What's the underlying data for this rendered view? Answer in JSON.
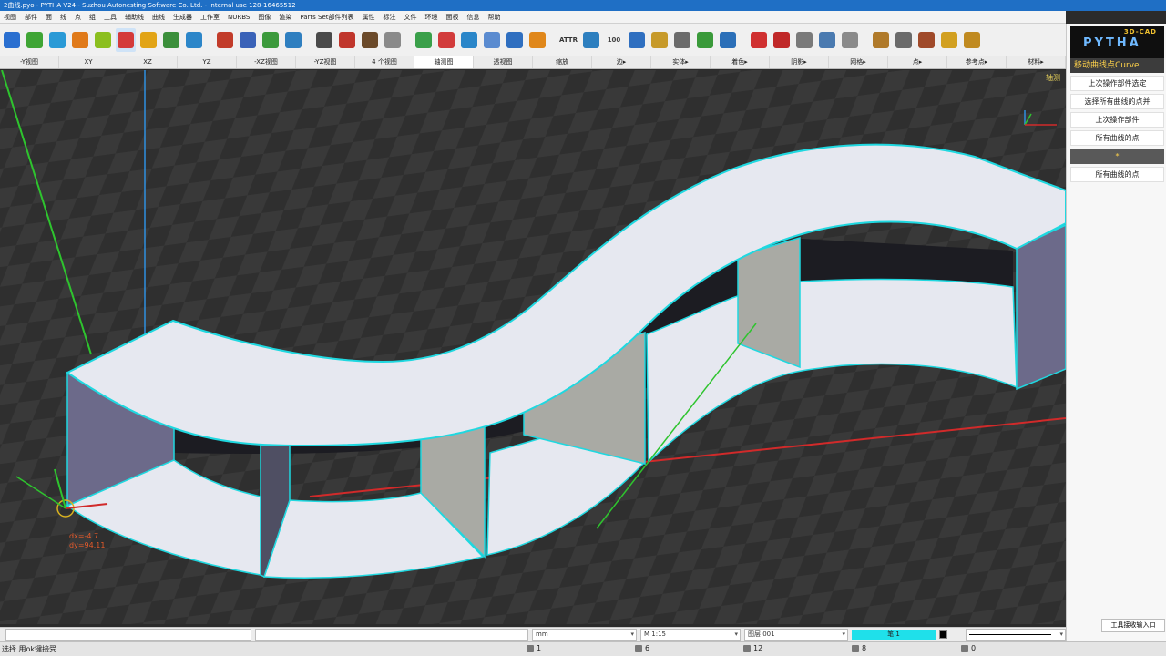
{
  "window": {
    "title": "2曲线.pyo - PYTHA V24 -        Suzhou Autonesting Software Co. Ltd. - Internal use    128-16465512"
  },
  "menu": [
    "视图",
    "部件",
    "面",
    "线",
    "点",
    "组",
    "工具",
    "辅助线",
    "曲线",
    "生成器",
    "工作室",
    "NURBS",
    "图像",
    "渲染",
    "Parts Set部件列表",
    "属性",
    "标注",
    "文件",
    "环境",
    "面板",
    "信息",
    "帮助"
  ],
  "toolbar": {
    "tools": [
      {
        "icon": "cube-arrow-icon",
        "color": "#2a6fd0"
      },
      {
        "icon": "green-block-icon",
        "color": "#3fa535"
      },
      {
        "icon": "plane-icon",
        "color": "#2a9ad6"
      },
      {
        "icon": "dots-icon",
        "color": "#e07a1a"
      },
      {
        "icon": "star-curve-icon",
        "color": "#8bbf1f"
      },
      {
        "icon": "curve-edit-icon",
        "color": "#d43a3a",
        "active": true
      },
      {
        "icon": "pattern-icon",
        "color": "#e2a416"
      },
      {
        "icon": "extrude-icon",
        "color": "#3b8f3b"
      },
      {
        "icon": "funnel-icon",
        "color": "#2c86c9"
      },
      {
        "sep": true
      },
      {
        "icon": "brush-red-icon",
        "color": "#c23c2a"
      },
      {
        "icon": "brush-blue-icon",
        "color": "#3a62b8"
      },
      {
        "icon": "brush-green-icon",
        "color": "#3c9a3c"
      },
      {
        "icon": "brush-pen-icon",
        "color": "#2f7fc0"
      },
      {
        "sep": true
      },
      {
        "icon": "person-icon",
        "color": "#4a4a4a"
      },
      {
        "icon": "figure-red-icon",
        "color": "#c0362c"
      },
      {
        "icon": "eye-icon",
        "color": "#6b4a2a"
      },
      {
        "icon": "eraser-icon",
        "color": "#8a8a8a"
      },
      {
        "sep": true
      },
      {
        "icon": "arrow-up-icon",
        "color": "#3aa04a"
      },
      {
        "icon": "rocket-icon",
        "color": "#d23b3b"
      },
      {
        "icon": "hook-icon",
        "color": "#2a86c9"
      },
      {
        "icon": "cup-icon",
        "color": "#5a8bd0"
      },
      {
        "icon": "undo-icon",
        "color": "#2f6fc0"
      },
      {
        "icon": "redo-icon",
        "color": "#e0871a"
      },
      {
        "sep": true
      },
      {
        "icon": "attr-icon",
        "color": "#333333",
        "text": "ATTR"
      },
      {
        "icon": "list-icon",
        "color": "#2d7fbf"
      },
      {
        "icon": "counter-icon",
        "color": "#444444",
        "text": "100"
      },
      {
        "icon": "text-t-icon",
        "color": "#2f6fc0"
      },
      {
        "icon": "hatch-icon",
        "color": "#c79a2a"
      },
      {
        "icon": "box-icon",
        "color": "#6b6b6b"
      },
      {
        "icon": "tree-icon",
        "color": "#3a9a3a"
      },
      {
        "icon": "info-icon",
        "color": "#2b6fb8"
      },
      {
        "sep": true
      },
      {
        "icon": "target-icon",
        "color": "#d03030"
      },
      {
        "icon": "close-red-icon",
        "color": "#c02828"
      },
      {
        "icon": "cabinet-icon",
        "color": "#7a7a7a"
      },
      {
        "icon": "cabinet-blue-icon",
        "color": "#4a7ab0"
      },
      {
        "icon": "cylinder-icon",
        "color": "#8a8a8a"
      },
      {
        "sep": true
      },
      {
        "icon": "books-icon",
        "color": "#b07a2a"
      },
      {
        "icon": "pencil-icon",
        "color": "#6a6a6a"
      },
      {
        "icon": "tools-icon",
        "color": "#a04a2a"
      },
      {
        "icon": "bread-icon",
        "color": "#d2a020"
      },
      {
        "icon": "scissors-icon",
        "color": "#c08a20"
      }
    ]
  },
  "viewbar": [
    "-Y视图",
    "XY",
    "XZ",
    "YZ",
    "-XZ视图",
    "-YZ视图",
    "4 个视图",
    "轴测图",
    "透视图",
    "缩放",
    "边▸",
    "实体▸",
    "着色▸",
    "阴影▸",
    "网格▸",
    "点▸",
    "参考点▸",
    "材料▸"
  ],
  "viewbar_active": 7,
  "viewport": {
    "view_label": "轴测",
    "coord_readout": "dx=-4.7\ndy=94.11",
    "colors": {
      "background": "#2f2f2f",
      "surface": "#e6e8f0",
      "edge": "#1fd8e0",
      "x_axis": "#d12a2a",
      "y_axis": "#2f8fe0",
      "z_axis": "#2ec42e"
    }
  },
  "panel": {
    "logo_top": "3D-CAD",
    "logo_main": "PYTHA",
    "title": "移动曲线点Curve",
    "items": [
      {
        "label": "上次操作部件选定",
        "dark": false
      },
      {
        "label": "选择所有曲线的点并",
        "dark": false
      },
      {
        "label": "上次操作部件",
        "dark": false
      },
      {
        "label": "所有曲线的点",
        "dark": false
      },
      {
        "label": "*",
        "dark": true
      },
      {
        "label": "所有曲线的点",
        "dark": false
      }
    ],
    "footer": "工具接收输入口"
  },
  "cmdbar": {
    "unit": "mm",
    "scale": "M 1:15",
    "layer": "图层 001",
    "pen": "笔 1"
  },
  "status": {
    "text": "选择 用ok键接受",
    "stats": [
      {
        "icon": "parts-icon",
        "value": "1"
      },
      {
        "icon": "faces-icon",
        "value": "6"
      },
      {
        "icon": "lines-icon",
        "value": "12"
      },
      {
        "icon": "points-icon",
        "value": "8"
      },
      {
        "icon": "groups-icon",
        "value": "0"
      }
    ]
  }
}
